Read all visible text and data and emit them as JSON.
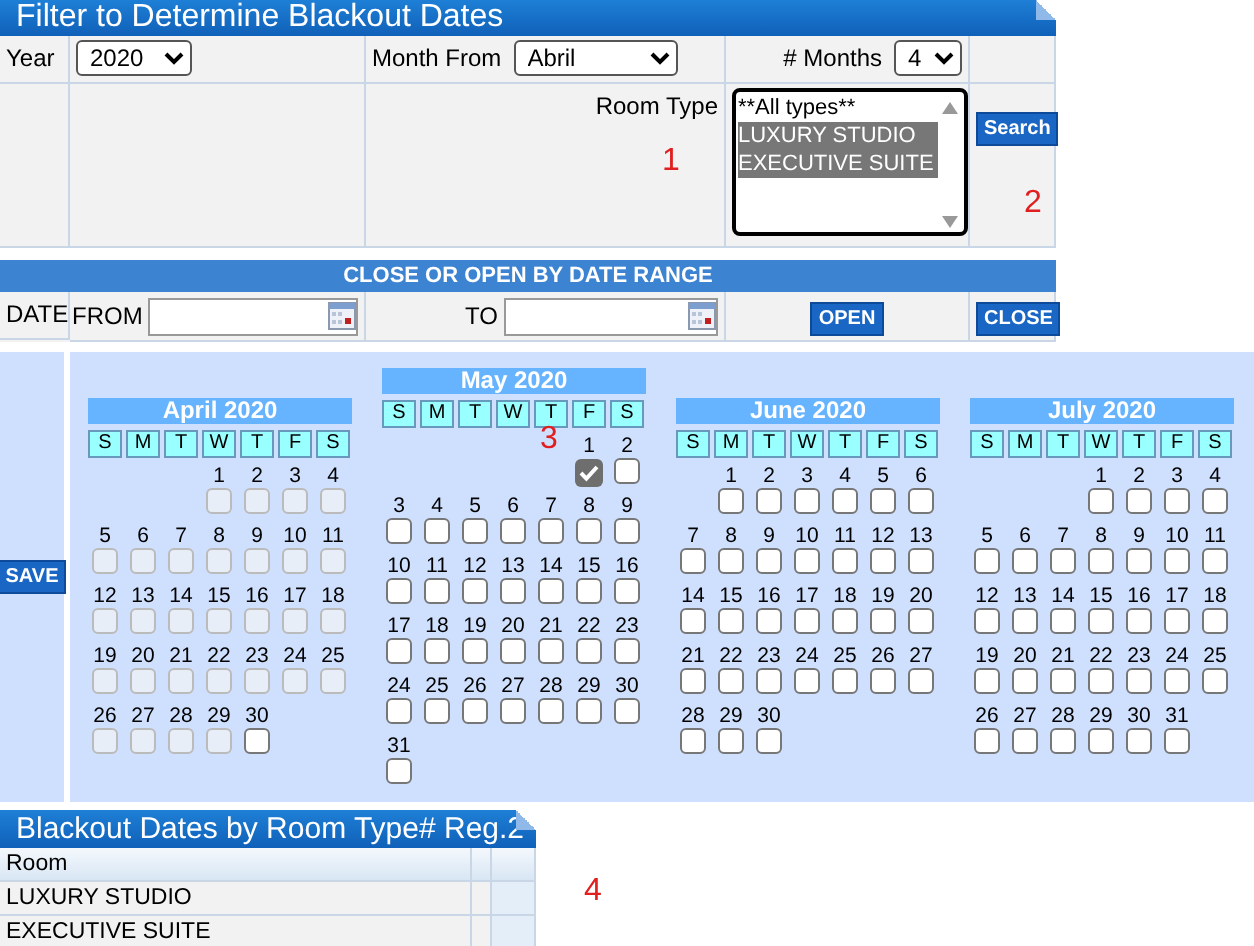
{
  "filter_panel": {
    "title": "Filter to Determine Blackout Dates",
    "year": {
      "label": "Year",
      "value": "2020"
    },
    "month_from": {
      "label": "Month From",
      "value": "Abril"
    },
    "months": {
      "label": "# Months",
      "value": "4"
    },
    "room_type": {
      "label": "Room Type",
      "options": [
        {
          "label": "**All types**",
          "selected": false
        },
        {
          "label": "LUXURY STUDIO",
          "selected": true
        },
        {
          "label": "EXECUTIVE SUITE",
          "selected": true
        }
      ]
    },
    "search_button": "Search",
    "range_bar": "CLOSE OR OPEN BY DATE RANGE",
    "date_label": "DATE",
    "from_label": "FROM",
    "to_label": "TO",
    "open_button": "OPEN",
    "close_button": "CLOSE"
  },
  "calendar": {
    "save_button": "SAVE",
    "months": [
      {
        "title": "April 2020",
        "weekdays": [
          "S",
          "M",
          "T",
          "W",
          "T",
          "F",
          "S"
        ],
        "weeks": [
          [
            {
              "d": "1",
              "checked": false,
              "disabled": true
            },
            {
              "d": "2",
              "checked": false,
              "disabled": true
            },
            {
              "d": "3",
              "checked": false,
              "disabled": true
            },
            {
              "d": "4",
              "checked": false,
              "disabled": true
            }
          ],
          [
            {
              "d": "5",
              "checked": false,
              "disabled": true
            },
            {
              "d": "6",
              "checked": false,
              "disabled": true
            },
            {
              "d": "7",
              "checked": false,
              "disabled": true
            },
            {
              "d": "8",
              "checked": false,
              "disabled": true
            },
            {
              "d": "9",
              "checked": false,
              "disabled": true
            },
            {
              "d": "10",
              "checked": false,
              "disabled": true
            },
            {
              "d": "11",
              "checked": false,
              "disabled": true
            }
          ],
          [
            {
              "d": "12",
              "checked": false,
              "disabled": true
            },
            {
              "d": "13",
              "checked": false,
              "disabled": true
            },
            {
              "d": "14",
              "checked": false,
              "disabled": true
            },
            {
              "d": "15",
              "checked": false,
              "disabled": true
            },
            {
              "d": "16",
              "checked": false,
              "disabled": true
            },
            {
              "d": "17",
              "checked": false,
              "disabled": true
            },
            {
              "d": "18",
              "checked": false,
              "disabled": true
            }
          ],
          [
            {
              "d": "19",
              "checked": false,
              "disabled": true
            },
            {
              "d": "20",
              "checked": false,
              "disabled": true
            },
            {
              "d": "21",
              "checked": false,
              "disabled": true
            },
            {
              "d": "22",
              "checked": false,
              "disabled": true
            },
            {
              "d": "23",
              "checked": false,
              "disabled": true
            },
            {
              "d": "24",
              "checked": false,
              "disabled": true
            },
            {
              "d": "25",
              "checked": false,
              "disabled": true
            }
          ],
          [
            {
              "d": "26",
              "checked": false,
              "disabled": true
            },
            {
              "d": "27",
              "checked": false,
              "disabled": true
            },
            {
              "d": "28",
              "checked": false,
              "disabled": true
            },
            {
              "d": "29",
              "checked": false,
              "disabled": true
            },
            {
              "d": "30",
              "checked": false,
              "disabled": false
            }
          ]
        ]
      },
      {
        "title": "May 2020",
        "weekdays": [
          "S",
          "M",
          "T",
          "W",
          "T",
          "F",
          "S"
        ],
        "weeks": [
          [
            {
              "d": "1",
              "checked": true,
              "disabled": true
            },
            {
              "d": "2",
              "checked": false,
              "disabled": false
            }
          ],
          [
            {
              "d": "3",
              "checked": false,
              "disabled": false
            },
            {
              "d": "4",
              "checked": false,
              "disabled": false
            },
            {
              "d": "5",
              "checked": false,
              "disabled": false
            },
            {
              "d": "6",
              "checked": false,
              "disabled": false
            },
            {
              "d": "7",
              "checked": false,
              "disabled": false
            },
            {
              "d": "8",
              "checked": false,
              "disabled": false
            },
            {
              "d": "9",
              "checked": false,
              "disabled": false
            }
          ],
          [
            {
              "d": "10",
              "checked": false,
              "disabled": false
            },
            {
              "d": "11",
              "checked": false,
              "disabled": false
            },
            {
              "d": "12",
              "checked": false,
              "disabled": false
            },
            {
              "d": "13",
              "checked": false,
              "disabled": false
            },
            {
              "d": "14",
              "checked": false,
              "disabled": false
            },
            {
              "d": "15",
              "checked": false,
              "disabled": false
            },
            {
              "d": "16",
              "checked": false,
              "disabled": false
            }
          ],
          [
            {
              "d": "17",
              "checked": false,
              "disabled": false
            },
            {
              "d": "18",
              "checked": false,
              "disabled": false
            },
            {
              "d": "19",
              "checked": false,
              "disabled": false
            },
            {
              "d": "20",
              "checked": false,
              "disabled": false
            },
            {
              "d": "21",
              "checked": false,
              "disabled": false
            },
            {
              "d": "22",
              "checked": false,
              "disabled": false
            },
            {
              "d": "23",
              "checked": false,
              "disabled": false
            }
          ],
          [
            {
              "d": "24",
              "checked": false,
              "disabled": false
            },
            {
              "d": "25",
              "checked": false,
              "disabled": false
            },
            {
              "d": "26",
              "checked": false,
              "disabled": false
            },
            {
              "d": "27",
              "checked": false,
              "disabled": false
            },
            {
              "d": "28",
              "checked": false,
              "disabled": false
            },
            {
              "d": "29",
              "checked": false,
              "disabled": false
            },
            {
              "d": "30",
              "checked": false,
              "disabled": false
            }
          ],
          [
            {
              "d": "31",
              "checked": false,
              "disabled": false
            }
          ]
        ]
      },
      {
        "title": "June 2020",
        "weekdays": [
          "S",
          "M",
          "T",
          "W",
          "T",
          "F",
          "S"
        ],
        "weeks": [
          [
            {
              "d": "1",
              "checked": false,
              "disabled": false
            },
            {
              "d": "2",
              "checked": false,
              "disabled": false
            },
            {
              "d": "3",
              "checked": false,
              "disabled": false
            },
            {
              "d": "4",
              "checked": false,
              "disabled": false
            },
            {
              "d": "5",
              "checked": false,
              "disabled": false
            },
            {
              "d": "6",
              "checked": false,
              "disabled": false
            }
          ],
          [
            {
              "d": "7",
              "checked": false,
              "disabled": false
            },
            {
              "d": "8",
              "checked": false,
              "disabled": false
            },
            {
              "d": "9",
              "checked": false,
              "disabled": false
            },
            {
              "d": "10",
              "checked": false,
              "disabled": false
            },
            {
              "d": "11",
              "checked": false,
              "disabled": false
            },
            {
              "d": "12",
              "checked": false,
              "disabled": false
            },
            {
              "d": "13",
              "checked": false,
              "disabled": false
            }
          ],
          [
            {
              "d": "14",
              "checked": false,
              "disabled": false
            },
            {
              "d": "15",
              "checked": false,
              "disabled": false
            },
            {
              "d": "16",
              "checked": false,
              "disabled": false
            },
            {
              "d": "17",
              "checked": false,
              "disabled": false
            },
            {
              "d": "18",
              "checked": false,
              "disabled": false
            },
            {
              "d": "19",
              "checked": false,
              "disabled": false
            },
            {
              "d": "20",
              "checked": false,
              "disabled": false
            }
          ],
          [
            {
              "d": "21",
              "checked": false,
              "disabled": false
            },
            {
              "d": "22",
              "checked": false,
              "disabled": false
            },
            {
              "d": "23",
              "checked": false,
              "disabled": false
            },
            {
              "d": "24",
              "checked": false,
              "disabled": false
            },
            {
              "d": "25",
              "checked": false,
              "disabled": false
            },
            {
              "d": "26",
              "checked": false,
              "disabled": false
            },
            {
              "d": "27",
              "checked": false,
              "disabled": false
            }
          ],
          [
            {
              "d": "28",
              "checked": false,
              "disabled": false
            },
            {
              "d": "29",
              "checked": false,
              "disabled": false
            },
            {
              "d": "30",
              "checked": false,
              "disabled": false
            }
          ]
        ]
      },
      {
        "title": "July 2020",
        "weekdays": [
          "S",
          "M",
          "T",
          "W",
          "T",
          "F",
          "S"
        ],
        "weeks": [
          [
            {
              "d": "1",
              "checked": false,
              "disabled": false
            },
            {
              "d": "2",
              "checked": false,
              "disabled": false
            },
            {
              "d": "3",
              "checked": false,
              "disabled": false
            },
            {
              "d": "4",
              "checked": false,
              "disabled": false
            }
          ],
          [
            {
              "d": "5",
              "checked": false,
              "disabled": false
            },
            {
              "d": "6",
              "checked": false,
              "disabled": false
            },
            {
              "d": "7",
              "checked": false,
              "disabled": false
            },
            {
              "d": "8",
              "checked": false,
              "disabled": false
            },
            {
              "d": "9",
              "checked": false,
              "disabled": false
            },
            {
              "d": "10",
              "checked": false,
              "disabled": false
            },
            {
              "d": "11",
              "checked": false,
              "disabled": false
            }
          ],
          [
            {
              "d": "12",
              "checked": false,
              "disabled": false
            },
            {
              "d": "13",
              "checked": false,
              "disabled": false
            },
            {
              "d": "14",
              "checked": false,
              "disabled": false
            },
            {
              "d": "15",
              "checked": false,
              "disabled": false
            },
            {
              "d": "16",
              "checked": false,
              "disabled": false
            },
            {
              "d": "17",
              "checked": false,
              "disabled": false
            },
            {
              "d": "18",
              "checked": false,
              "disabled": false
            }
          ],
          [
            {
              "d": "19",
              "checked": false,
              "disabled": false
            },
            {
              "d": "20",
              "checked": false,
              "disabled": false
            },
            {
              "d": "21",
              "checked": false,
              "disabled": false
            },
            {
              "d": "22",
              "checked": false,
              "disabled": false
            },
            {
              "d": "23",
              "checked": false,
              "disabled": false
            },
            {
              "d": "24",
              "checked": false,
              "disabled": false
            },
            {
              "d": "25",
              "checked": false,
              "disabled": false
            }
          ],
          [
            {
              "d": "26",
              "checked": false,
              "disabled": false
            },
            {
              "d": "27",
              "checked": false,
              "disabled": false
            },
            {
              "d": "28",
              "checked": false,
              "disabled": false
            },
            {
              "d": "29",
              "checked": false,
              "disabled": false
            },
            {
              "d": "30",
              "checked": false,
              "disabled": false
            },
            {
              "d": "31",
              "checked": false,
              "disabled": false
            }
          ]
        ]
      }
    ]
  },
  "results_panel": {
    "title": "Blackout Dates by Room Type# Reg.2",
    "columns": [
      "Room"
    ],
    "rows": [
      "LUXURY STUDIO",
      "EXECUTIVE SUITE"
    ]
  },
  "callouts": [
    "1",
    "2",
    "3",
    "4"
  ]
}
